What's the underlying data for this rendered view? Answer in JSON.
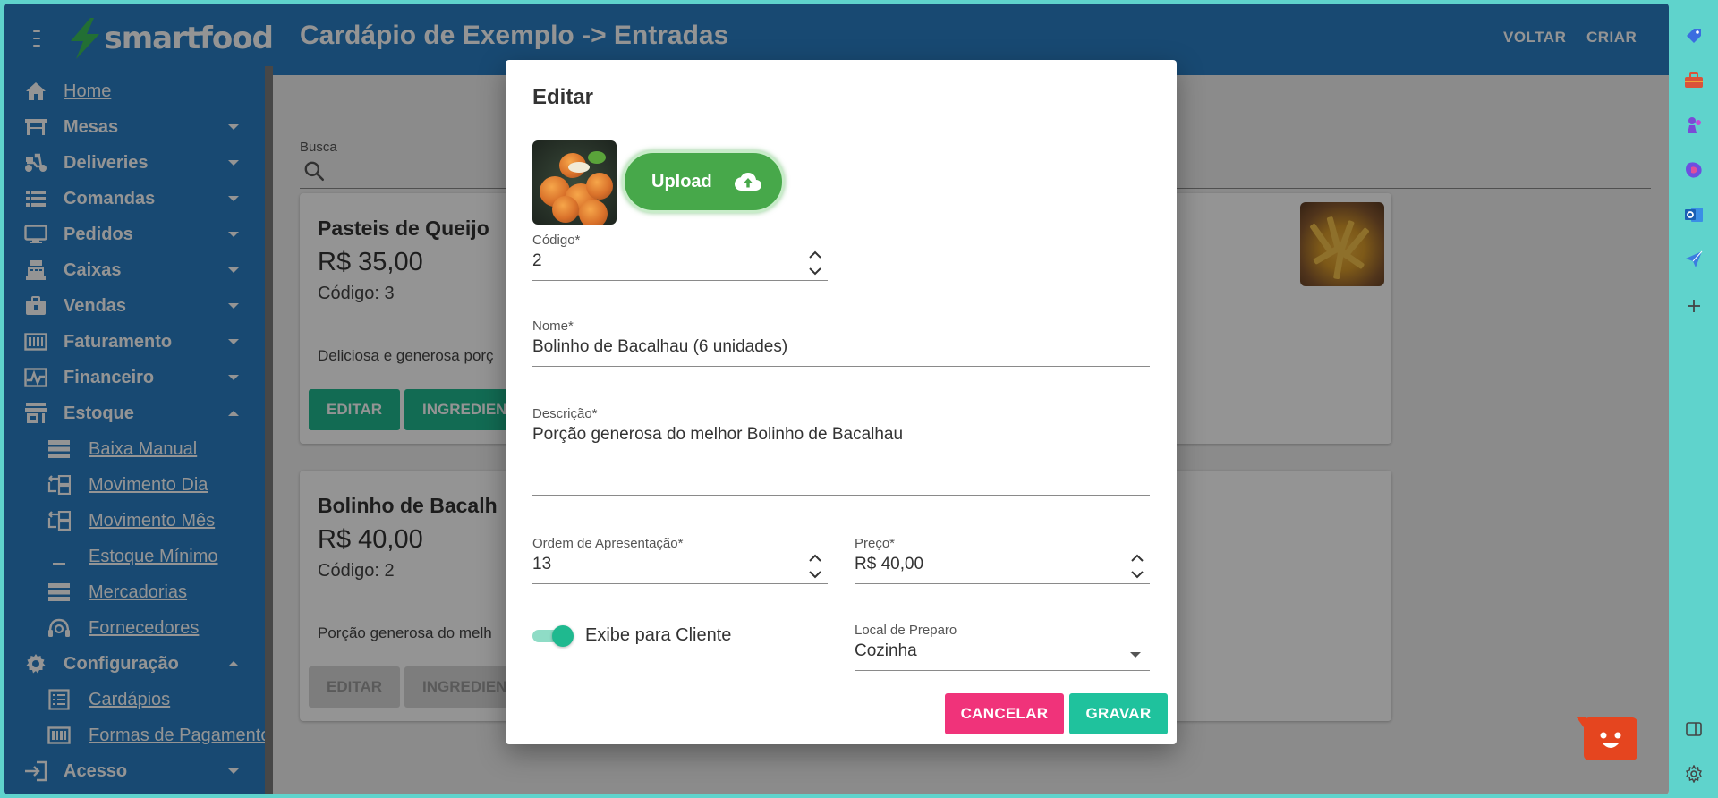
{
  "brand": {
    "logo_text": "smartfood"
  },
  "sidebar": {
    "items": [
      {
        "label": "Home",
        "icon": "home-icon",
        "kind": "top",
        "caret": "none"
      },
      {
        "label": "Mesas",
        "icon": "table-icon",
        "kind": "top",
        "caret": "down"
      },
      {
        "label": "Deliveries",
        "icon": "scooter-icon",
        "kind": "top",
        "caret": "down"
      },
      {
        "label": "Comandas",
        "icon": "list-icon",
        "kind": "top",
        "caret": "down"
      },
      {
        "label": "Pedidos",
        "icon": "monitor-icon",
        "kind": "top",
        "caret": "down"
      },
      {
        "label": "Caixas",
        "icon": "register-icon",
        "kind": "top",
        "caret": "down"
      },
      {
        "label": "Vendas",
        "icon": "briefcase-icon",
        "kind": "top",
        "caret": "down"
      },
      {
        "label": "Faturamento",
        "icon": "billing-icon",
        "kind": "top",
        "caret": "down"
      },
      {
        "label": "Financeiro",
        "icon": "chart-icon",
        "kind": "top",
        "caret": "down"
      },
      {
        "label": "Estoque",
        "icon": "store-icon",
        "kind": "top",
        "caret": "up"
      },
      {
        "label": "Baixa Manual",
        "icon": "stack-icon",
        "kind": "sub"
      },
      {
        "label": "Movimento Dia",
        "icon": "movement-icon",
        "kind": "sub"
      },
      {
        "label": "Movimento Mês",
        "icon": "movement-icon",
        "kind": "sub"
      },
      {
        "label": "Estoque Mínimo",
        "icon": "minimum-icon",
        "kind": "sub"
      },
      {
        "label": "Mercadorias",
        "icon": "stack-icon",
        "kind": "sub"
      },
      {
        "label": "Fornecedores",
        "icon": "support-icon",
        "kind": "sub"
      },
      {
        "label": "Configuração",
        "icon": "gear-icon",
        "kind": "top",
        "caret": "up"
      },
      {
        "label": "Cardápios",
        "icon": "menu-list-icon",
        "kind": "sub"
      },
      {
        "label": "Formas de Pagamento",
        "icon": "billing-icon",
        "kind": "sub"
      },
      {
        "label": "Acesso",
        "icon": "login-icon",
        "kind": "top",
        "caret": "down"
      }
    ]
  },
  "header": {
    "title": "Cardápio de Exemplo -> Entradas",
    "back_label": "VOLTAR",
    "create_label": "CRIAR"
  },
  "search": {
    "label": "Busca"
  },
  "cards": [
    {
      "title": "Pasteis de Queijo",
      "price": "R$ 35,00",
      "code": "Código: 3",
      "description": "Deliciosa e generosa porç",
      "edit_label": "EDITAR",
      "ingredients_label": "INGREDIEN"
    },
    {
      "title": "Bolinho de Bacalh",
      "price": "R$ 40,00",
      "code": "Código: 2",
      "description": "Porção generosa do melh",
      "edit_label": "EDITAR",
      "ingredients_label": "INGREDIEN"
    }
  ],
  "dialog": {
    "title": "Editar",
    "upload_label": "Upload",
    "fields": {
      "codigo": {
        "label": "Código*",
        "value": "2"
      },
      "nome": {
        "label": "Nome*",
        "value": "Bolinho de Bacalhau (6 unidades)"
      },
      "descricao": {
        "label": "Descrição*",
        "value": "Porção generosa do melhor Bolinho de Bacalhau"
      },
      "ordem": {
        "label": "Ordem de Apresentação*",
        "value": "13"
      },
      "preco": {
        "label": "Preço*",
        "value": "R$ 40,00"
      },
      "local": {
        "label": "Local de Preparo",
        "value": "Cozinha"
      }
    },
    "toggle": {
      "label": "Exibe para Cliente",
      "checked": true
    },
    "cancel_label": "CANCELAR",
    "save_label": "GRAVAR"
  },
  "colors": {
    "primary": "#2a7fc4",
    "accent_green": "#1fb98f",
    "upload_green": "#47a84a",
    "cancel_pink": "#f0337a",
    "chat_orange": "#e5451f",
    "browser_teal": "#5fd3cc"
  }
}
